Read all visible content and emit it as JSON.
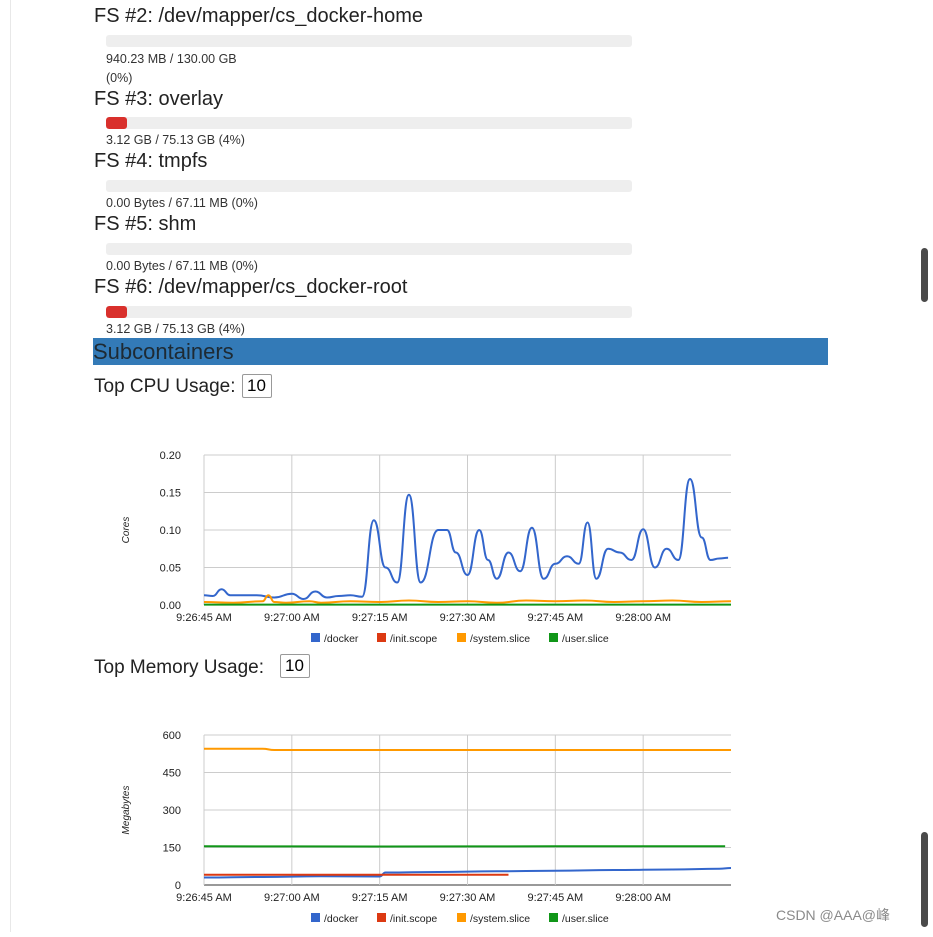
{
  "filesystems": [
    {
      "title": "FS #2: /dev/mapper/cs_docker-home",
      "usage": "940.23 MB / 130.00 GB",
      "percent_text": "(0%)",
      "fill_percent": 0
    },
    {
      "title": "FS #3: overlay",
      "usage": "3.12 GB / 75.13 GB (4%)",
      "fill_percent": 4
    },
    {
      "title": "FS #4: tmpfs",
      "usage": "0.00 Bytes / 67.11 MB (0%)",
      "fill_percent": 0
    },
    {
      "title": "FS #5: shm",
      "usage": "0.00 Bytes / 67.11 MB (0%)",
      "fill_percent": 0
    },
    {
      "title": "FS #6: /dev/mapper/cs_docker-root",
      "usage": "3.12 GB / 75.13 GB (4%)",
      "fill_percent": 4
    }
  ],
  "subcontainers": {
    "title": "Subcontainers",
    "cpu": {
      "label": "Top CPU Usage:",
      "value": "10"
    },
    "memory": {
      "label": "Top Memory Usage:",
      "value": "10"
    }
  },
  "colors": {
    "docker": "#3366cc",
    "init": "#dc3912",
    "system": "#ff9900",
    "user": "#109618",
    "header": "#337ab7",
    "bar_fill": "#d9302c"
  },
  "watermark": "CSDN @AAA@峰",
  "chart_data": [
    {
      "type": "line",
      "ylabel": "Cores",
      "ylim": [
        0,
        0.2
      ],
      "yticks": [
        "0.00",
        "0.05",
        "0.10",
        "0.15",
        "0.20"
      ],
      "xlim_seconds": [
        0,
        90
      ],
      "xticks": [
        "9:26:45 AM",
        "9:27:00 AM",
        "9:27:15 AM",
        "9:27:30 AM",
        "9:27:45 AM",
        "9:28:00 AM"
      ],
      "legend": [
        "/docker",
        "/init.scope",
        "/system.slice",
        "/user.slice"
      ],
      "legend_position": "bottom",
      "series": [
        {
          "name": "/docker",
          "color": "#3366cc",
          "x": [
            0,
            1.5,
            3,
            4.5,
            6,
            9,
            12,
            15,
            17,
            19,
            21,
            23,
            25,
            27,
            29,
            31,
            33,
            35,
            37,
            40,
            41.5,
            43,
            45,
            47,
            48.5,
            50,
            52,
            54,
            56,
            58,
            60,
            62,
            64,
            65.5,
            67,
            69,
            71,
            73,
            75,
            77,
            79,
            81,
            83,
            85,
            86.5,
            88,
            89.5
          ],
          "y": [
            0.013,
            0.012,
            0.021,
            0.013,
            0.013,
            0.013,
            0.01,
            0.015,
            0.008,
            0.018,
            0.01,
            0.012,
            0.013,
            0.011,
            0.113,
            0.05,
            0.03,
            0.147,
            0.03,
            0.1,
            0.1,
            0.07,
            0.04,
            0.1,
            0.06,
            0.035,
            0.07,
            0.045,
            0.103,
            0.035,
            0.055,
            0.065,
            0.055,
            0.11,
            0.035,
            0.075,
            0.07,
            0.06,
            0.101,
            0.05,
            0.075,
            0.06,
            0.168,
            0.09,
            0.06,
            0.062,
            0.063
          ]
        },
        {
          "name": "/system.slice",
          "color": "#ff9900",
          "x": [
            0,
            5,
            10,
            11,
            12,
            14,
            18,
            20,
            25,
            30,
            35,
            40,
            45,
            50,
            55,
            60,
            65,
            70,
            75,
            80,
            85,
            90
          ],
          "y": [
            0.004,
            0.003,
            0.005,
            0.013,
            0.004,
            0.003,
            0.005,
            0.003,
            0.005,
            0.004,
            0.006,
            0.004,
            0.005,
            0.003,
            0.006,
            0.005,
            0.006,
            0.004,
            0.005,
            0.006,
            0.004,
            0.005
          ]
        },
        {
          "name": "/user.slice",
          "color": "#109618",
          "x": [
            0,
            90
          ],
          "y": [
            0.0005,
            0.0005
          ]
        }
      ]
    },
    {
      "type": "line",
      "ylabel": "Megabytes",
      "ylim": [
        0,
        600
      ],
      "yticks": [
        "0",
        "150",
        "300",
        "450",
        "600"
      ],
      "xlim_seconds": [
        0,
        90
      ],
      "xticks": [
        "9:26:45 AM",
        "9:27:00 AM",
        "9:27:15 AM",
        "9:27:30 AM",
        "9:27:45 AM",
        "9:28:00 AM"
      ],
      "legend": [
        "/docker",
        "/init.scope",
        "/system.slice",
        "/user.slice"
      ],
      "legend_position": "bottom",
      "series": [
        {
          "name": "/docker",
          "color": "#3366cc",
          "x": [
            0,
            10,
            20,
            30,
            31,
            40,
            50,
            60,
            70,
            80,
            88,
            90
          ],
          "y": [
            30,
            32,
            35,
            34,
            50,
            52,
            55,
            57,
            60,
            62,
            65,
            68
          ]
        },
        {
          "name": "/init.scope",
          "color": "#dc3912",
          "x": [
            0,
            30,
            31,
            52
          ],
          "y": [
            41,
            41,
            41,
            41
          ]
        },
        {
          "name": "/system.slice",
          "color": "#ff9900",
          "x": [
            0,
            10,
            12,
            30,
            50,
            70,
            90
          ],
          "y": [
            545,
            545,
            540,
            540,
            540,
            540,
            540
          ]
        },
        {
          "name": "/user.slice",
          "color": "#109618",
          "x": [
            0,
            30,
            60,
            89
          ],
          "y": [
            155,
            154,
            155,
            155
          ]
        }
      ]
    }
  ]
}
